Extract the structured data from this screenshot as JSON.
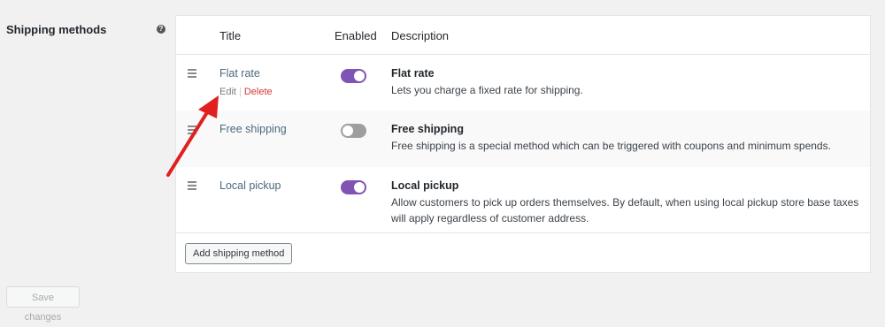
{
  "section": {
    "label": "Shipping methods",
    "help_icon": "question-mark-icon"
  },
  "table": {
    "headers": {
      "title": "Title",
      "enabled": "Enabled",
      "description": "Description"
    },
    "rows": [
      {
        "title": "Flat rate",
        "enabled": true,
        "desc_title": "Flat rate",
        "desc_text": "Lets you charge a fixed rate for shipping.",
        "edit_label": "Edit",
        "separator": "|",
        "delete_label": "Delete"
      },
      {
        "title": "Free shipping",
        "enabled": false,
        "desc_title": "Free shipping",
        "desc_text": "Free shipping is a special method which can be triggered with coupons and minimum spends."
      },
      {
        "title": "Local pickup",
        "enabled": true,
        "desc_title": "Local pickup",
        "desc_text": "Allow customers to pick up orders themselves. By default, when using local pickup store base taxes will apply regardless of customer address."
      }
    ],
    "add_button_label": "Add shipping method"
  },
  "footer": {
    "save_label": "Save changes"
  },
  "colors": {
    "toggle_on": "#7f54b3",
    "toggle_off": "#9e9e9e",
    "delete": "#d63638",
    "annotation_arrow": "#e02020"
  },
  "icons": {
    "drag_handle": "drag-handle-icon",
    "annotation": "red-arrow-annotation"
  }
}
